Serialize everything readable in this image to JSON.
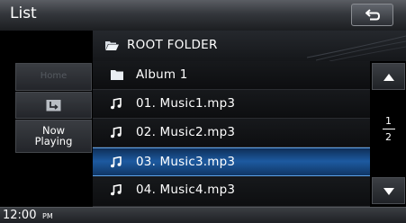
{
  "header": {
    "title": "List"
  },
  "folder": {
    "label": "ROOT FOLDER"
  },
  "sidebar": {
    "home_label": "Home",
    "now_playing_line1": "Now",
    "now_playing_line2": "Playing"
  },
  "list": {
    "items": [
      {
        "label": "Album 1",
        "icon": "folder-icon"
      },
      {
        "label": "01. Music1.mp3",
        "icon": "music-note-icon"
      },
      {
        "label": "02. Music2.mp3",
        "icon": "music-note-icon"
      },
      {
        "label": "03. Music3.mp3",
        "icon": "music-note-icon",
        "selected": true
      },
      {
        "label": "04. Music4.mp3",
        "icon": "music-note-icon"
      }
    ]
  },
  "pager": {
    "current": "1",
    "total": "2"
  },
  "status": {
    "time": "12:00",
    "ampm": "PM"
  },
  "colors": {
    "selection": "#1d5aa0",
    "selection_border": "#5ea2e8",
    "background": "#000000"
  }
}
